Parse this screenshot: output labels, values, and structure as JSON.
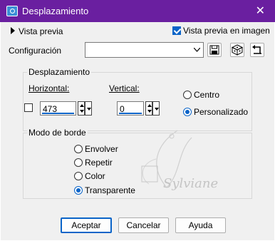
{
  "window": {
    "title": "Desplazamiento",
    "close_glyph": "✕"
  },
  "preview": {
    "label": "Vista previa",
    "checkbox_label": "Vista previa en imagen",
    "checked": true
  },
  "config": {
    "label": "Configuración",
    "value": ""
  },
  "offset_group": {
    "title": "Desplazamiento",
    "horizontal": {
      "label": "Horizontal:",
      "value": "473"
    },
    "vertical": {
      "label": "Vertical:",
      "value": "0"
    },
    "centro_label": "Centro",
    "personalizado_label": "Personalizado",
    "selected": "personalizado"
  },
  "border_group": {
    "title": "Modo de borde",
    "options": [
      "Envolver",
      "Repetir",
      "Color",
      "Transparente"
    ],
    "selected": "Transparente"
  },
  "watermark": {
    "text": "Sylviane"
  },
  "buttons": {
    "ok": "Aceptar",
    "cancel": "Cancelar",
    "help": "Ayuda"
  },
  "colors": {
    "titlebar": "#6a1fa0",
    "accent": "#0a64c8"
  }
}
